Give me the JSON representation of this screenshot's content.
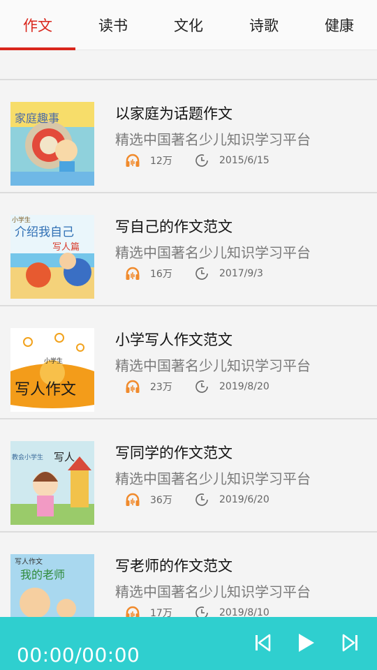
{
  "tabs": [
    {
      "label": "作文",
      "active": true
    },
    {
      "label": "读书",
      "active": false
    },
    {
      "label": "文化",
      "active": false
    },
    {
      "label": "诗歌",
      "active": false
    },
    {
      "label": "健康",
      "active": false
    }
  ],
  "colors": {
    "accent": "#d9261c",
    "player": "#2fcfcf",
    "headphone": "#f08a2c"
  },
  "items": [
    {
      "title": "以家庭为话题作文",
      "desc": "精选中国著名少儿知识学习平台",
      "plays": "12万",
      "date": "2015/6/15",
      "thumb_text": "家庭趣事"
    },
    {
      "title": "写自己的作文范文",
      "desc": "精选中国著名少儿知识学习平台",
      "plays": "16万",
      "date": "2017/9/3",
      "thumb_text": "介绍我自己",
      "thumb_sub": "写人篇",
      "thumb_top": "小学生"
    },
    {
      "title": "小学写人作文范文",
      "desc": "精选中国著名少儿知识学习平台",
      "plays": "23万",
      "date": "2019/8/20",
      "thumb_text": "写人作文",
      "thumb_top": "小学生"
    },
    {
      "title": "写同学的作文范文",
      "desc": "精选中国著名少儿知识学习平台",
      "plays": "36万",
      "date": "2019/6/20",
      "thumb_text": "写人",
      "thumb_top": "教会小学生"
    },
    {
      "title": "写老师的作文范文",
      "desc": "精选中国著名少儿知识学习平台",
      "plays": "17万",
      "date": "2019/8/10",
      "thumb_text": "我的老师",
      "thumb_top": "写人作文"
    }
  ],
  "player": {
    "time": "00:00/00:00"
  }
}
